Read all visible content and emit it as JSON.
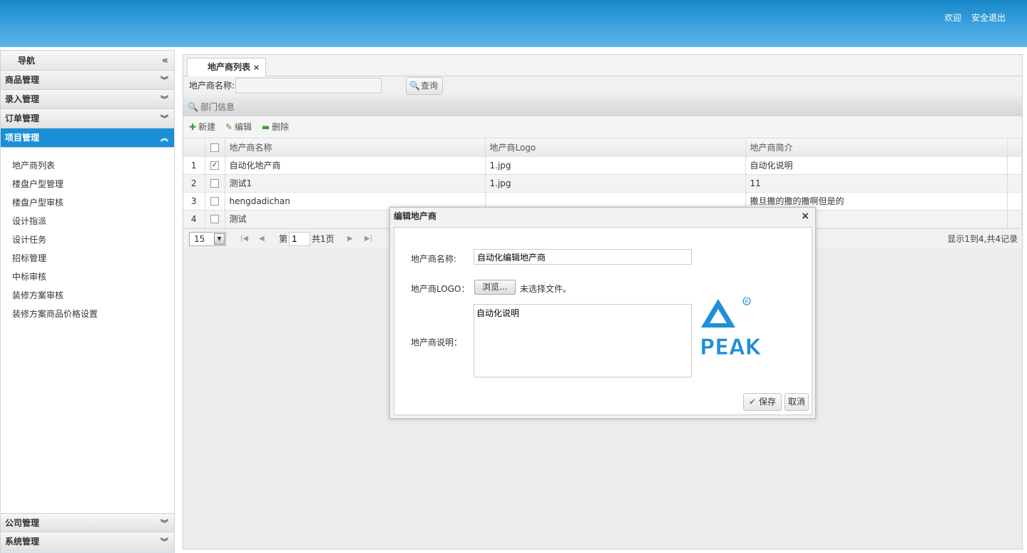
{
  "header": {
    "welcome": "欢迎",
    "logout": "安全退出"
  },
  "sidebar": {
    "title": "导航",
    "sections": [
      {
        "label": "商品管理"
      },
      {
        "label": "录入管理"
      },
      {
        "label": "订单管理"
      },
      {
        "label": "项目管理"
      }
    ],
    "sub_items": [
      "地产商列表",
      "楼盘户型管理",
      "楼盘户型审核",
      "设计指派",
      "设计任务",
      "招标管理",
      "中标审核",
      "装修方案审核",
      "装修方案商品价格设置"
    ],
    "bottom_sections": [
      {
        "label": "公司管理"
      },
      {
        "label": "系统管理"
      }
    ]
  },
  "main": {
    "tab_label": "地产商列表",
    "search_label": "地产商名称:",
    "search_value": "",
    "query_button": "查询",
    "section_title": "部门信息",
    "toolbar": {
      "new": "新建",
      "edit": "编辑",
      "delete": "删除"
    },
    "columns": [
      "地产商名称",
      "地产商Logo",
      "地产商简介"
    ],
    "rows": [
      {
        "num": "1",
        "checked": true,
        "name": "自动化地产商",
        "logo": "1.jpg",
        "intro": "自动化说明"
      },
      {
        "num": "2",
        "checked": false,
        "name": "测试1",
        "logo": "1.jpg",
        "intro": "11"
      },
      {
        "num": "3",
        "checked": false,
        "name": "hengdadichan",
        "logo": "",
        "intro": "撒旦撒的撒的撒啊但是的"
      },
      {
        "num": "4",
        "checked": false,
        "name": "测试",
        "logo": "",
        "intro": ""
      }
    ],
    "pager": {
      "page_size": "15",
      "page_prefix": "第",
      "page": "1",
      "total_pages": "共1页",
      "info": "显示1到4,共4记录"
    }
  },
  "dialog": {
    "title": "编辑地产商",
    "name_label": "地产商名称:",
    "name_value": "自动化编辑地产商",
    "logo_label": "地产商LOGO：",
    "browse_button": "浏览…",
    "no_file": "未选择文件。",
    "desc_label": "地产商说明：",
    "desc_value": "自动化说明",
    "logo_text": "PEAK",
    "save_button": "保存",
    "cancel_button": "取消"
  }
}
